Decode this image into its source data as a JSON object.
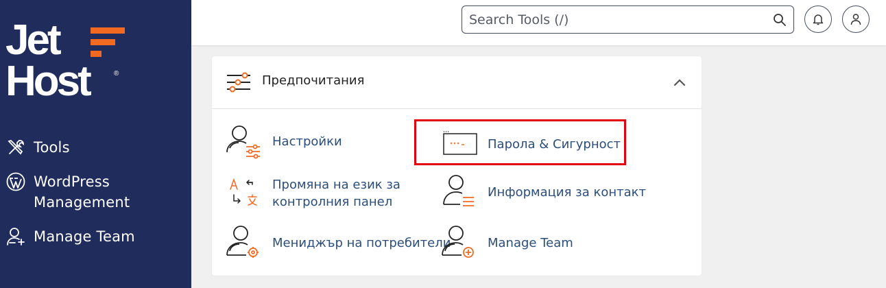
{
  "brand": {
    "line1": "Jet",
    "line2": "Host",
    "registered": "®",
    "accent": "#f26a21",
    "sidebar_bg": "#1f2c5c"
  },
  "sidebar": {
    "items": [
      {
        "label": "Tools",
        "icon": "tools-icon"
      },
      {
        "label": "WordPress Management",
        "icon": "wordpress-icon"
      },
      {
        "label": "Manage Team",
        "icon": "add-user-icon"
      }
    ]
  },
  "header": {
    "search": {
      "placeholder": "Search Tools (/)",
      "value": "",
      "icon": "search-icon"
    },
    "notifications_icon": "bell-icon",
    "user_icon": "user-icon"
  },
  "section": {
    "title": "Предпочитания",
    "icon": "sliders-icon",
    "collapse_icon": "chevron-up-icon",
    "tools": [
      {
        "label": "Настройки",
        "icon": "user-settings-icon"
      },
      {
        "label": "Парола & Сигурност",
        "icon": "password-icon",
        "highlighted": true,
        "highlight_color": "#e5000e"
      },
      {
        "label_line1": "Промяна на език за",
        "label_line2": "контролния панел",
        "icon": "language-icon"
      },
      {
        "label": "Информация за контакт",
        "icon": "contact-info-icon"
      },
      {
        "label": "Мениджър на потребители",
        "icon": "user-manager-icon"
      },
      {
        "label": "Manage Team",
        "icon": "manage-team-icon"
      }
    ]
  }
}
